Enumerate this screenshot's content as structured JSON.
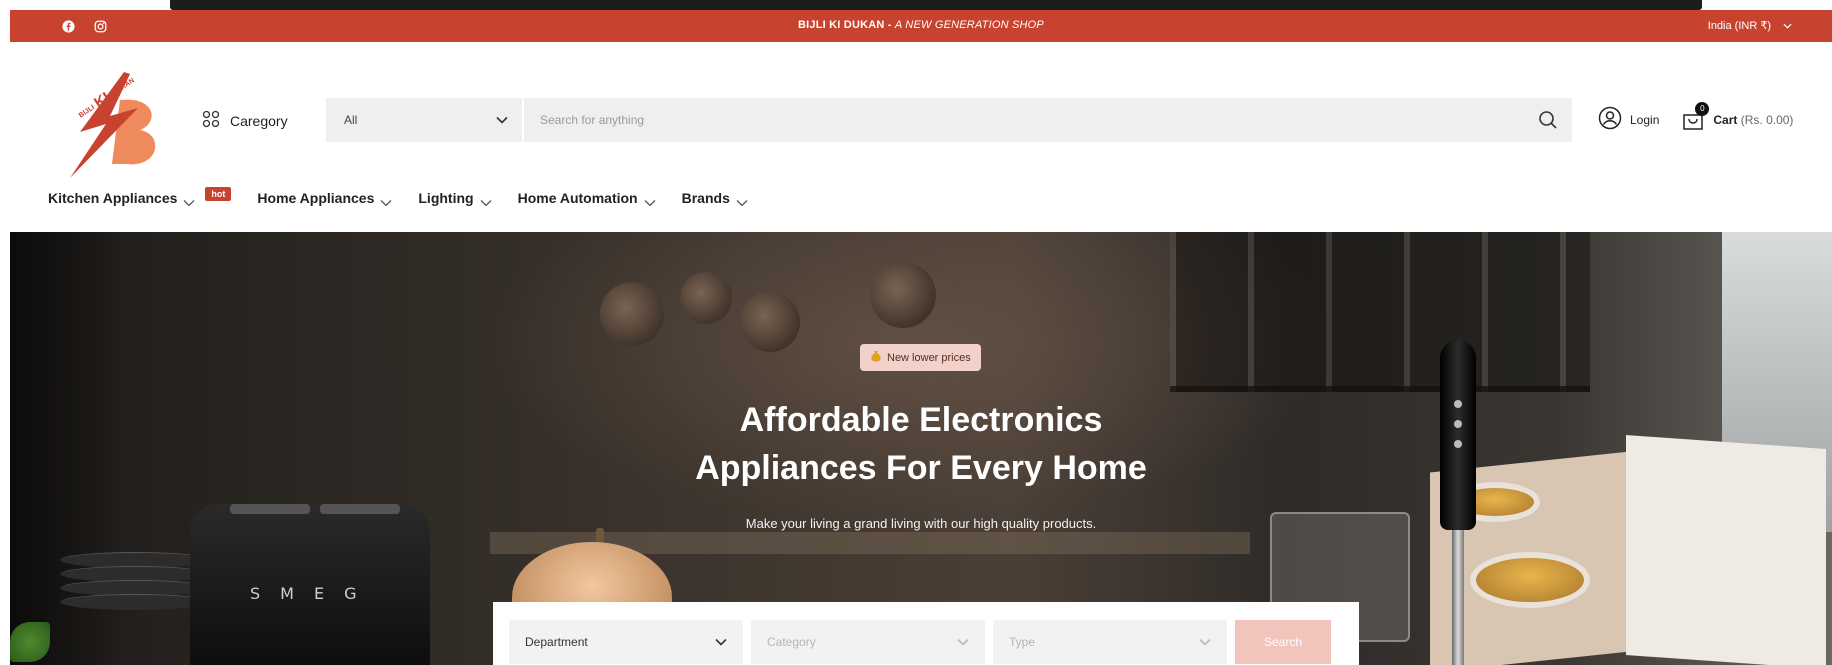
{
  "topbar": {
    "social": [
      "facebook-icon",
      "instagram-icon"
    ],
    "announcement_brand": "BIJLI KI DUKAN",
    "announcement_sep": " - ",
    "announcement_tagline": "A NEW GENERATION SHOP",
    "locale": "India (INR ₹)"
  },
  "header": {
    "logo_text": "BIJLI KI DUKAN",
    "category_label": "Caregory",
    "search_scope": "All",
    "search_placeholder": "Search for anything",
    "login_label": "Login",
    "cart_label": "Cart",
    "cart_price": "(Rs. 0.00)",
    "cart_count": "0"
  },
  "nav": {
    "items": [
      {
        "label": "Kitchen Appliances",
        "badge": "hot"
      },
      {
        "label": "Home Appliances"
      },
      {
        "label": "Lighting"
      },
      {
        "label": "Home Automation"
      },
      {
        "label": "Brands"
      }
    ]
  },
  "hero": {
    "badge": "New lower prices",
    "title_line1": "Affordable Electronics",
    "title_line2": "Appliances For Every Home",
    "subtitle": "Make your living a grand living with our high quality products.",
    "toaster_brand": "SMEG"
  },
  "filters": {
    "department": "Department",
    "category": "Category",
    "type": "Type",
    "button": "Search"
  },
  "colors": {
    "brand_red": "#c8432f",
    "badge_pink": "#f2d1cb",
    "button_pink": "#f2c4bc"
  }
}
